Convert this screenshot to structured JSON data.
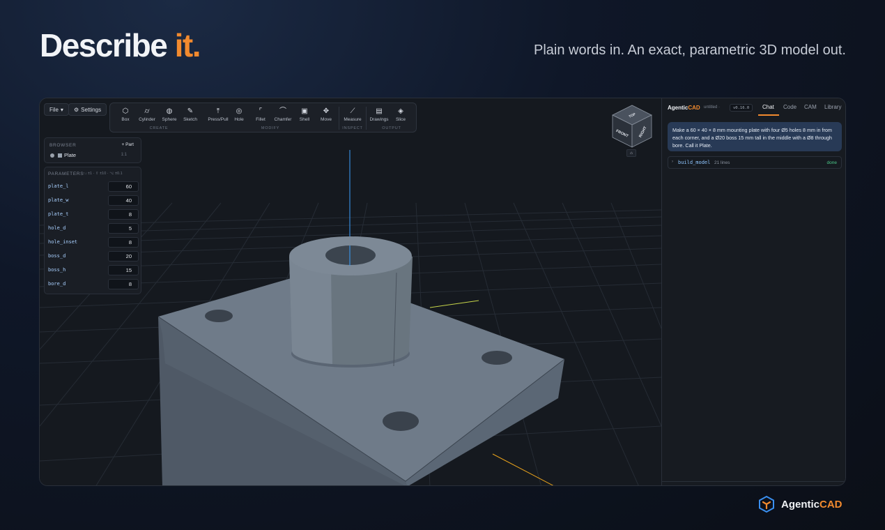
{
  "hero": {
    "title_main": "Describe",
    "title_accent": "it.",
    "tagline": "Plain words in. An exact, parametric 3D model out."
  },
  "topbar": {
    "file_label": "File",
    "settings_label": "Settings"
  },
  "toolbar": {
    "tools": [
      {
        "label": "Box",
        "icon": "cube-icon"
      },
      {
        "label": "Cylinder",
        "icon": "cylinder-icon"
      },
      {
        "label": "Sphere",
        "icon": "sphere-icon"
      },
      {
        "label": "Sketch",
        "icon": "pencil-icon"
      },
      {
        "label": "Press/Pull",
        "icon": "press-pull-icon"
      },
      {
        "label": "Hole",
        "icon": "hole-icon"
      },
      {
        "label": "Fillet",
        "icon": "fillet-icon"
      },
      {
        "label": "Chamfer",
        "icon": "chamfer-icon"
      },
      {
        "label": "Shell",
        "icon": "shell-icon"
      },
      {
        "label": "Move",
        "icon": "move-icon"
      },
      {
        "label": "Measure",
        "icon": "ruler-icon"
      },
      {
        "label": "Drawings",
        "icon": "document-icon"
      },
      {
        "label": "Slice",
        "icon": "layers-icon"
      }
    ],
    "groups": [
      "CREATE",
      "MODIFY",
      "INSPECT",
      "OUTPUT"
    ]
  },
  "browser": {
    "heading": "BROWSER",
    "add_part": "+ Part",
    "item_label": "Plate",
    "item_meta": "1:1"
  },
  "parameters": {
    "heading": "PARAMETERS",
    "hint": "↑↓ ±1 · ⇧ ±10 · ⌥ ±0.1",
    "rows": [
      {
        "name": "plate_l",
        "value": "60"
      },
      {
        "name": "plate_w",
        "value": "40"
      },
      {
        "name": "plate_t",
        "value": "8"
      },
      {
        "name": "hole_d",
        "value": "5"
      },
      {
        "name": "hole_inset",
        "value": "8"
      },
      {
        "name": "boss_d",
        "value": "20"
      },
      {
        "name": "boss_h",
        "value": "15"
      },
      {
        "name": "bore_d",
        "value": "8"
      }
    ]
  },
  "viewcube": {
    "top": "TOP",
    "front": "FRONT",
    "right": "RIGHT",
    "home": "⌂"
  },
  "sidebar": {
    "brand_main": "Agentic",
    "brand_accent": "CAD",
    "doc_name": "untitled ·",
    "version": "v0.16.0",
    "tabs": [
      "Chat",
      "Code",
      "CAM",
      "Library"
    ],
    "active_tab": "Chat",
    "user_message": "Make a 60 × 40 × 8 mm mounting plate with four Ø5 holes 8 mm in from each corner, and a Ø20 boss 15 mm tall in the middle with a Ø8 through bore. Call it Plate.",
    "tool_call": {
      "name": "build_model",
      "lines": "21 lines",
      "status": "done"
    }
  },
  "footer": {
    "brand_main": "Agentic",
    "brand_accent": "CAD"
  },
  "colors": {
    "accent": "#f28a2e",
    "background": "#0b0f17",
    "model": "#6f7d8c",
    "axis_z": "#3aa0ff",
    "axis_x": "#e8a21c",
    "axis_y": "#c8d64a"
  }
}
